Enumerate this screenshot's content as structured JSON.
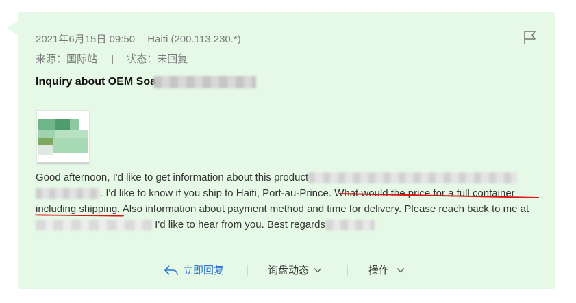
{
  "message": {
    "datetime": "2021年6月15日 09:50",
    "location": "Haiti (200.113.230.*)",
    "source_label": "来源：国际站",
    "separator": "|",
    "status_label": "状态：未回复",
    "title": "Inquiry about OEM Soa",
    "body": {
      "p1": "Good afternoon, I'd like to get information about this product",
      "p2": ". I'd like to know if you ship to Haiti, Port-au-Prince. ",
      "p3": "What would the price for a full container including shipping",
      "p4": ". Also information about payment method and time for delivery. Please reach back to me at",
      "p5": "I'd like to hear from you. Best regards"
    }
  },
  "actions": {
    "reply_label": "立即回复",
    "inquiry_status_label": "询盘动态",
    "operate_label": "操作"
  },
  "colors": {
    "card_bg": "#e6f9e6",
    "accent_blue": "#2a6fd4",
    "annotation_red": "#e01515"
  },
  "icons": [
    "flag-icon",
    "reply-arrow-icon",
    "chevron-down-icon"
  ]
}
